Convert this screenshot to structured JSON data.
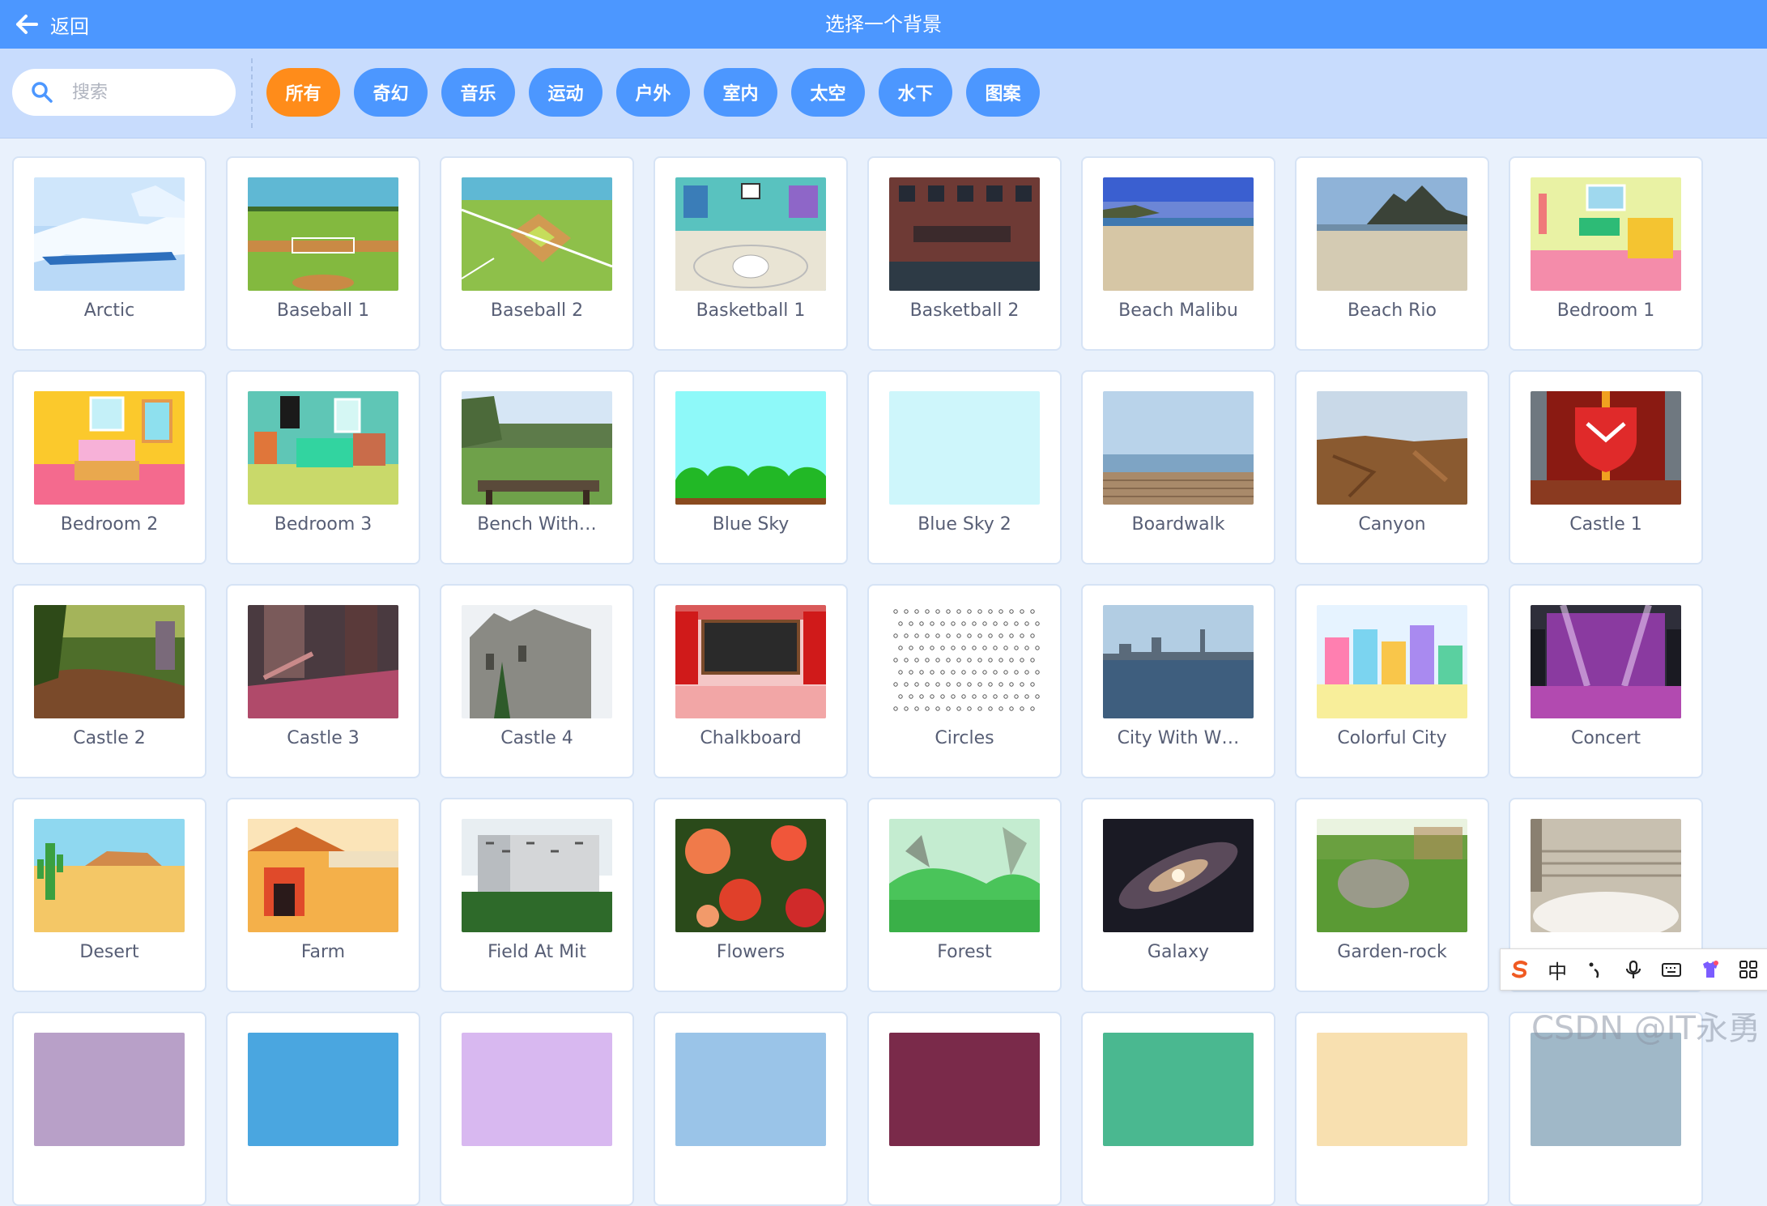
{
  "header": {
    "back_label": "返回",
    "title": "选择一个背景"
  },
  "search": {
    "placeholder": "搜索"
  },
  "tags": [
    "所有",
    "奇幻",
    "音乐",
    "运动",
    "户外",
    "室内",
    "太空",
    "水下",
    "图案"
  ],
  "active_tag": "所有",
  "backdrops": [
    {
      "name": "Arctic",
      "art": "arctic"
    },
    {
      "name": "Baseball 1",
      "art": "baseball1"
    },
    {
      "name": "Baseball 2",
      "art": "baseball2"
    },
    {
      "name": "Basketball 1",
      "art": "basketball1"
    },
    {
      "name": "Basketball 2",
      "art": "basketball2"
    },
    {
      "name": "Beach Malibu",
      "art": "beachmalibu"
    },
    {
      "name": "Beach Rio",
      "art": "beachrio"
    },
    {
      "name": "Bedroom 1",
      "art": "bedroom1"
    },
    {
      "name": "Bedroom 2",
      "art": "bedroom2"
    },
    {
      "name": "Bedroom 3",
      "art": "bedroom3"
    },
    {
      "name": "Bench With…",
      "art": "bench"
    },
    {
      "name": "Blue Sky",
      "art": "bluesky"
    },
    {
      "name": "Blue Sky 2",
      "art": "bluesky2"
    },
    {
      "name": "Boardwalk",
      "art": "boardwalk"
    },
    {
      "name": "Canyon",
      "art": "canyon"
    },
    {
      "name": "Castle 1",
      "art": "castle1"
    },
    {
      "name": "Castle 2",
      "art": "castle2"
    },
    {
      "name": "Castle 3",
      "art": "castle3"
    },
    {
      "name": "Castle 4",
      "art": "castle4"
    },
    {
      "name": "Chalkboard",
      "art": "chalkboard"
    },
    {
      "name": "Circles",
      "art": "circles"
    },
    {
      "name": "City With W…",
      "art": "citywater"
    },
    {
      "name": "Colorful City",
      "art": "colorfulcity"
    },
    {
      "name": "Concert",
      "art": "concert"
    },
    {
      "name": "Desert",
      "art": "desert"
    },
    {
      "name": "Farm",
      "art": "farm"
    },
    {
      "name": "Field At Mit",
      "art": "fieldmit"
    },
    {
      "name": "Flowers",
      "art": "flowers"
    },
    {
      "name": "Forest",
      "art": "forest"
    },
    {
      "name": "Galaxy",
      "art": "galaxy"
    },
    {
      "name": "Garden-rock",
      "art": "gardenrock"
    },
    {
      "name": "",
      "art": "greekstage"
    },
    {
      "name": "",
      "art": "r5a"
    },
    {
      "name": "",
      "art": "r5b"
    },
    {
      "name": "",
      "art": "r5c"
    },
    {
      "name": "",
      "art": "r5d"
    },
    {
      "name": "",
      "art": "r5e"
    },
    {
      "name": "",
      "art": "r5f"
    },
    {
      "name": "",
      "art": "r5g"
    },
    {
      "name": "",
      "art": "r5h"
    }
  ],
  "ime_bar": {
    "mode_label": "中"
  },
  "watermark": "CSDN @IT永勇"
}
